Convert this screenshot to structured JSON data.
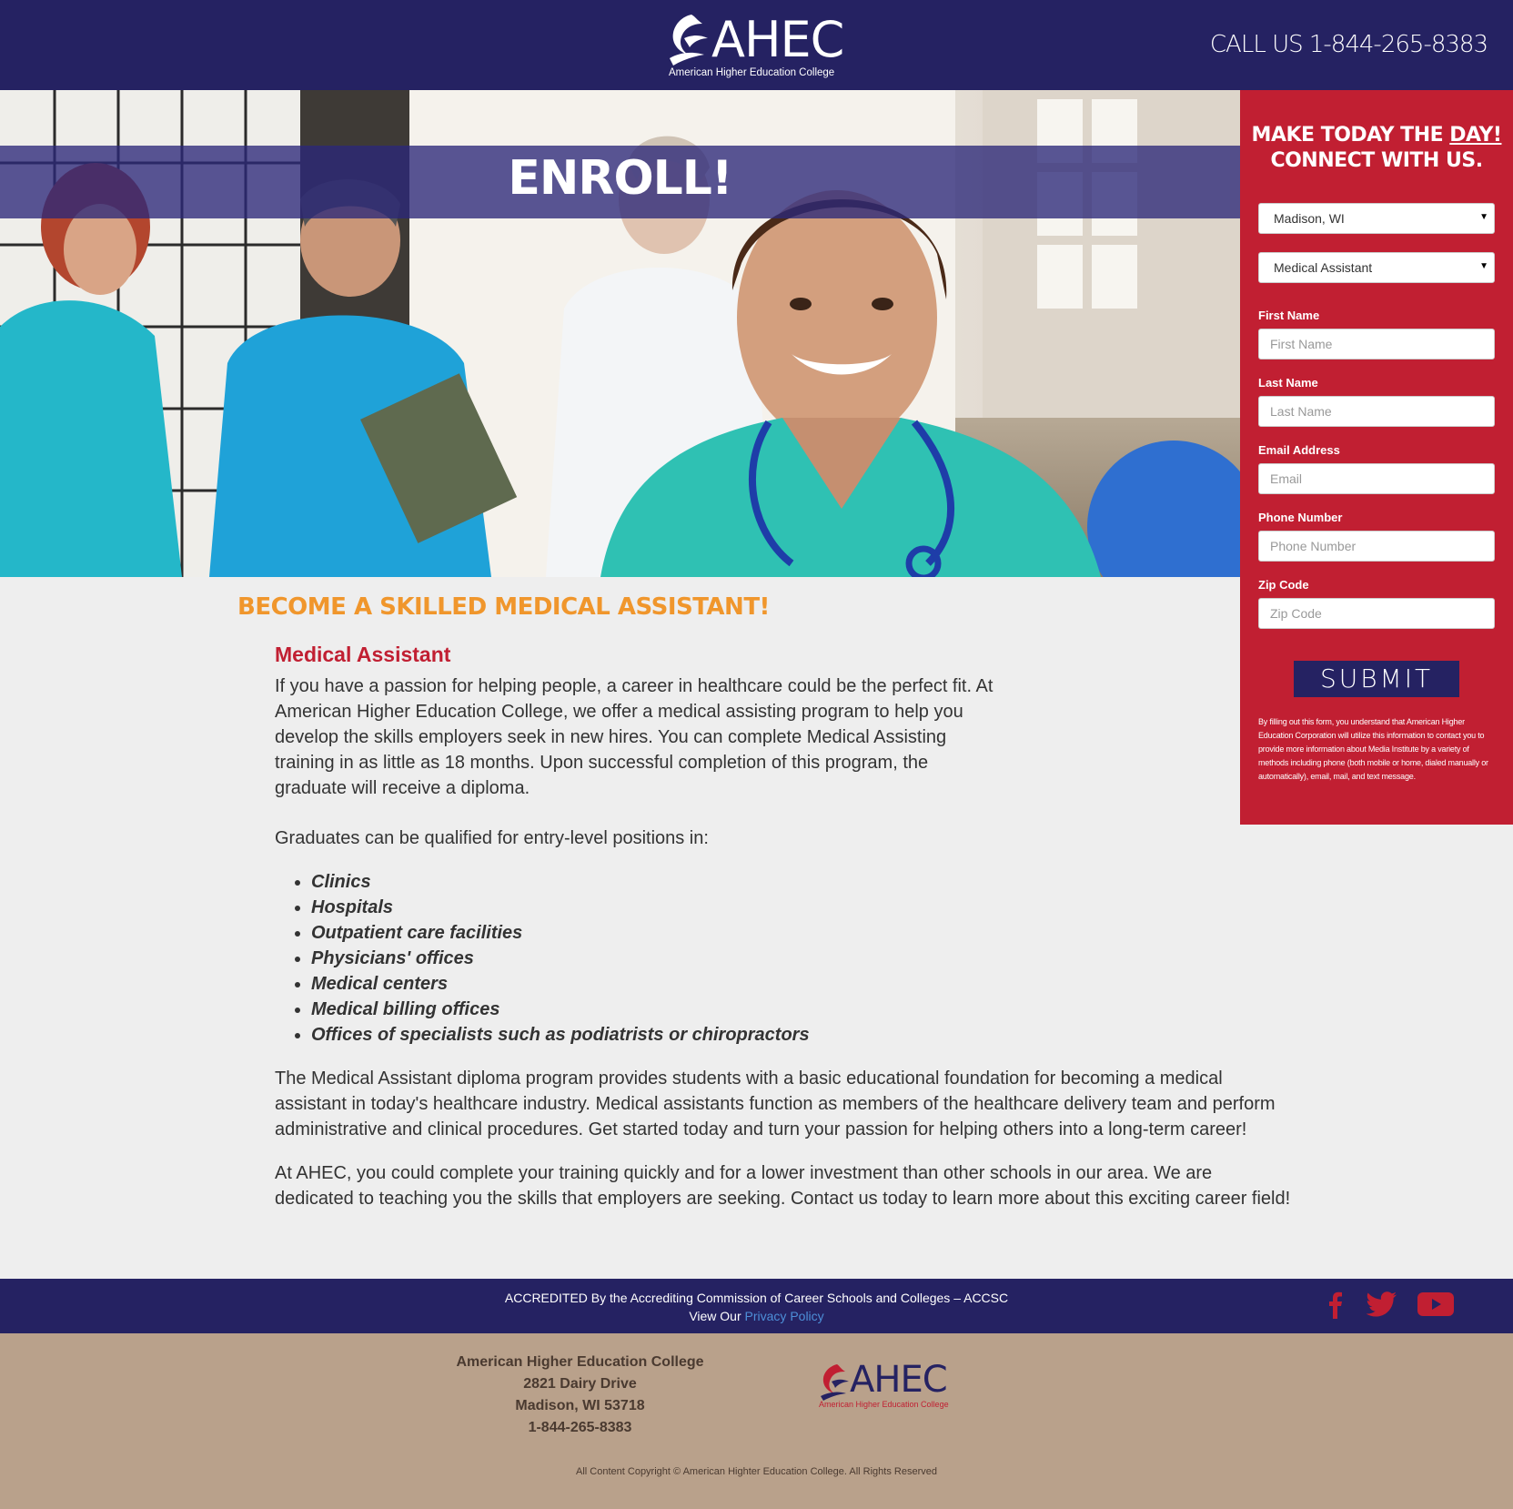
{
  "header": {
    "logo_text": "AHEC",
    "logo_subtitle": "American Higher Education College",
    "call": "CALL US 1-844-265-8383"
  },
  "hero": {
    "banner": "ENROLL!"
  },
  "form": {
    "title_line1_prefix": "MAKE TODAY THE ",
    "title_line1_emph": "DAY!",
    "title_line2": "CONNECT WITH US.",
    "location_select": "Madison, WI",
    "program_select": "Medical Assistant",
    "fields": [
      {
        "label": "First Name",
        "placeholder": "First Name"
      },
      {
        "label": "Last Name",
        "placeholder": "Last Name"
      },
      {
        "label": "Email Address",
        "placeholder": "Email"
      },
      {
        "label": "Phone Number",
        "placeholder": "Phone Number"
      },
      {
        "label": "Zip Code",
        "placeholder": "Zip Code"
      }
    ],
    "submit": "SUBMIT",
    "disclaimer": "By filling out this form, you understand that American Higher Education Corporation will utilize this information to contact you to provide more information about Media Institute by a variety of methods including phone (both mobile or home, dialed manually or automatically), email, mail, and text message."
  },
  "main": {
    "section_heading": "BECOME A SKILLED MEDICAL ASSISTANT!",
    "program_title": "Medical Assistant",
    "paragraph1": "If you have a passion for helping people, a career in healthcare could be the perfect fit. At American Higher Education College, we offer a medical assisting program to help you develop the skills employers seek in new hires. You can complete Medical Assisting training in as little as 18 months. Upon successful completion of this program, the graduate will receive a diploma.",
    "paragraph2": "Graduates can be qualified for entry-level positions in:",
    "positions": [
      "Clinics",
      "Hospitals",
      "Outpatient care facilities",
      "Physicians' offices",
      "Medical centers",
      "Medical billing offices",
      "Offices of specialists such as podiatrists or chiropractors"
    ],
    "paragraph3": "The Medical Assistant diploma program provides students with a basic educational foundation for becoming a medical assistant in today's healthcare industry. Medical assistants function as members of the healthcare delivery team and perform administrative and clinical procedures. Get started today and turn your passion for helping others into a long-term career!",
    "paragraph4": "At AHEC, you could complete your training quickly and for a lower investment than other schools in our area. We are dedicated to teaching you the skills that employers are seeking. Contact us today to learn more about this exciting career field!"
  },
  "footer": {
    "accreditation": "ACCREDITED By the Accrediting Commission of Career Schools and Colleges – ACCSC",
    "privacy_prefix": "View Our ",
    "privacy_link": "Privacy Policy",
    "social": [
      "facebook-icon",
      "twitter-icon",
      "youtube-icon"
    ],
    "address_name": "American Higher Education College",
    "address_street": "2821 Dairy Drive",
    "address_city": "Madison, WI 53718",
    "address_phone": "1-844-265-8383",
    "logo_text": "AHEC",
    "logo_subtitle": "American Higher Education College",
    "copyright": "All Content Copyright © American Highter Education College. All Rights Reserved"
  },
  "colors": {
    "navy": "#252262",
    "red": "#c11f32",
    "orange": "#f0962c",
    "tan": "#b9a18b"
  }
}
